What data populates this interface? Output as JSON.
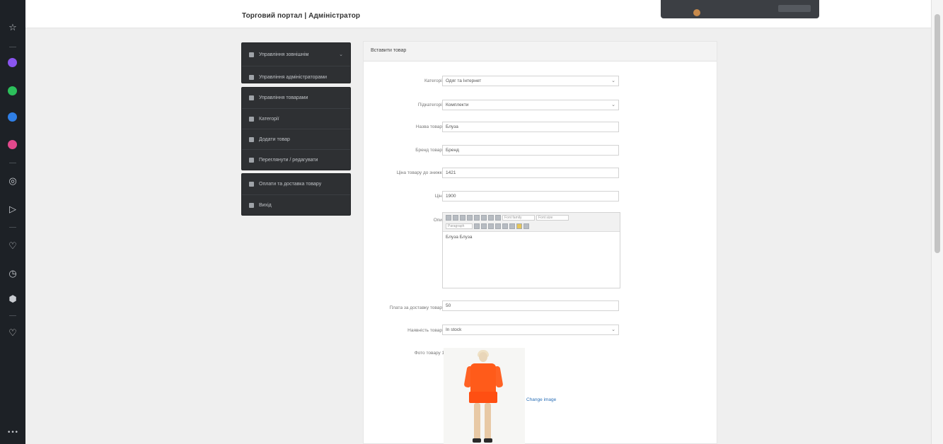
{
  "header": {
    "title": "Торговий портал | Адміністратор"
  },
  "rail": {
    "icons": [
      "star-icon",
      "messenger-icon",
      "whatsapp-icon",
      "telegram-icon",
      "instagram-icon",
      "target-icon",
      "send-icon",
      "heart-icon",
      "clock-icon",
      "cube-icon",
      "heart-notification-icon",
      "more-icon"
    ],
    "more_label": "•••"
  },
  "menu": {
    "group1": [
      "Управління зовнішнім",
      "Управління адміністраторами"
    ],
    "group2": [
      "Управління товарами",
      "Категорії",
      "Додати товар",
      "Переглянути / редагувати"
    ],
    "group3": [
      "Оплати та доставка товару",
      "Вихід"
    ],
    "chevron": "⌄"
  },
  "panel": {
    "title": "Вставити товар"
  },
  "form": {
    "category_label": "Категорія:",
    "category_value": "Одяг та Інтернет",
    "subcategory_label": "Підкатегорія:",
    "subcategory_value": "Комплекти",
    "title_label": "Назва товару:",
    "title_value": "Блуза",
    "brand_label": "Бренд товару:",
    "brand_value": "Бренд",
    "price_before_label": "Ціна товару до знижки:",
    "price_before_value": "1421",
    "price_label": "Ціна:",
    "price_value": "1900",
    "desc_label": "Опис:",
    "desc_value": "Блуза Блуза",
    "editor_font_family": "Font family",
    "editor_font_size": "Font size",
    "editor_paragraph": "Paragraph",
    "delivery_label": "Плата за доставку товару:",
    "delivery_value": "50",
    "availability_label": "Наявність товару:",
    "availability_value": "In stock",
    "photo_label": "Фото товару 1:",
    "change_image": "Change image"
  }
}
